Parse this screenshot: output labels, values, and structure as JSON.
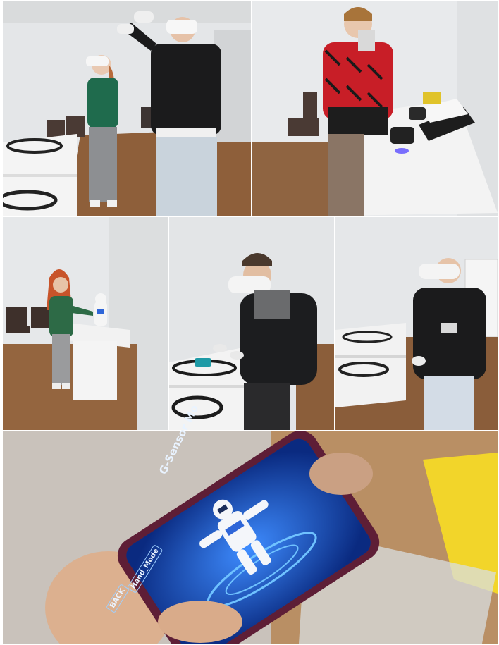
{
  "tiles": [
    {
      "id": "vr-pair-room"
    },
    {
      "id": "robot-car-demo"
    },
    {
      "id": "humanoid-robot-table"
    },
    {
      "id": "vr-student-track-table"
    },
    {
      "id": "vr-student-jacket"
    },
    {
      "id": "phone-robot-app"
    }
  ],
  "phone_app": {
    "mode_title": "G-Sensor Mo",
    "hand_mode_label": "Hand_Mode",
    "back_label": "BACK"
  },
  "colors": {
    "wall": "#e6e8ea",
    "floor": "#9a6a42",
    "table": "#f2f2f2",
    "app_blue": "#1a5bd8",
    "yellow_box": "#f2d52a"
  }
}
